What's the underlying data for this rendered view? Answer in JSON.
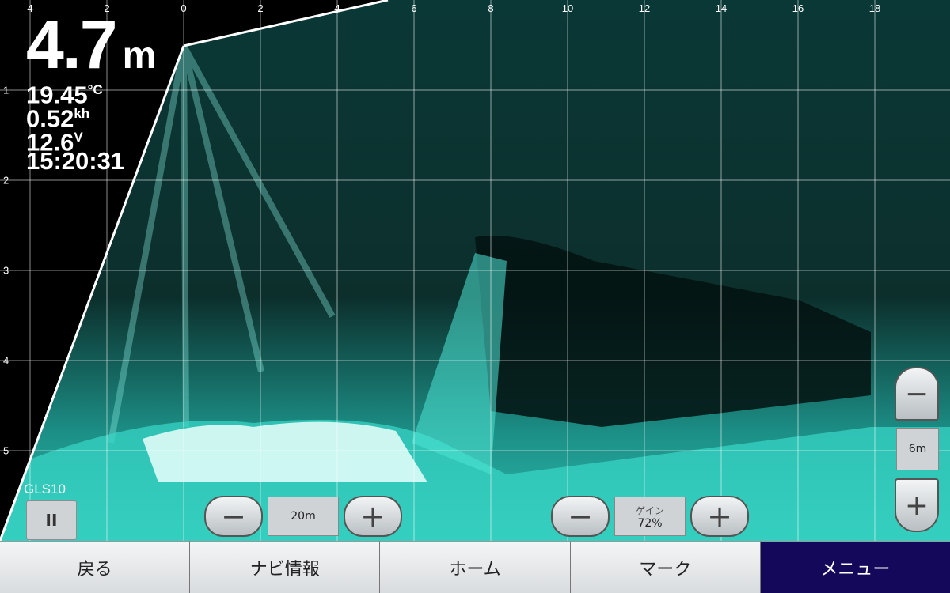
{
  "sonar": {
    "x_ticks": [
      "4",
      "2",
      "0",
      "2",
      "4",
      "6",
      "8",
      "10",
      "12",
      "14",
      "16",
      "18"
    ],
    "y_ticks": [
      "1",
      "2",
      "3",
      "4",
      "5"
    ]
  },
  "readouts": {
    "depth": "4.7",
    "depth_unit": "m",
    "temp": "19.45",
    "temp_unit": "°C",
    "speed": "0.52",
    "speed_unit": "kh",
    "voltage": "12.6",
    "voltage_unit": "V",
    "time": "15:20:31"
  },
  "source_label": "GLS10",
  "pause_label": "II",
  "range_control": {
    "minus": "−",
    "value": "20m",
    "plus": "+"
  },
  "gain_control": {
    "minus": "−",
    "caption": "ゲイン",
    "value": "72%",
    "plus": "+"
  },
  "zoom_control": {
    "minus": "−",
    "value": "6m",
    "plus": "+"
  },
  "menu": {
    "items": [
      "戻る",
      "ナビ情報",
      "ホーム",
      "マーク",
      "メニュー"
    ]
  },
  "colors": {
    "echo": "#3fd9c8",
    "menu_active": "#14085a"
  }
}
